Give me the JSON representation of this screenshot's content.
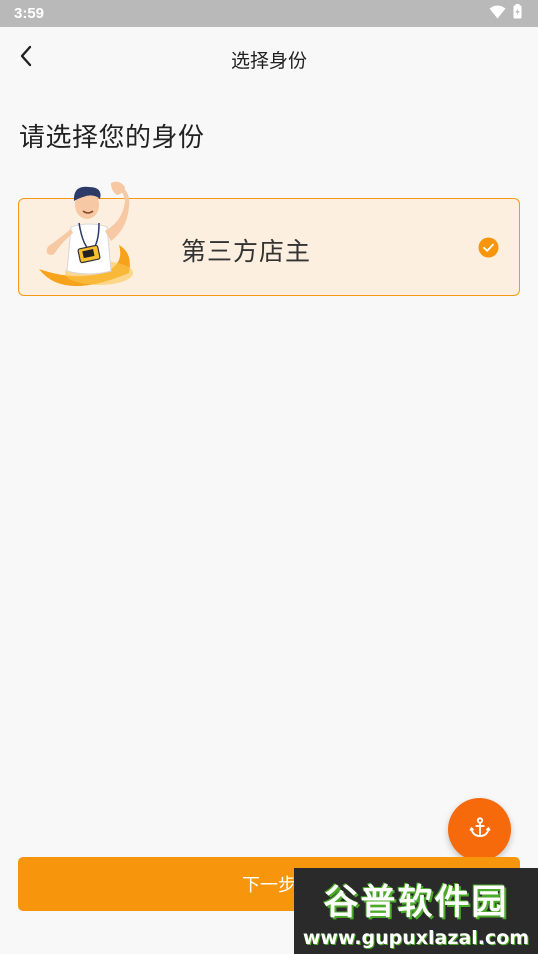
{
  "status_bar": {
    "time": "3:59"
  },
  "app_bar": {
    "title": "选择身份"
  },
  "heading": "请选择您的身份",
  "roles": [
    {
      "label": "第三方店主",
      "selected": true
    }
  ],
  "actions": {
    "next_label": "下一步"
  },
  "watermark": {
    "title": "谷普软件园",
    "url": "www.gupuxlazal.com"
  },
  "colors": {
    "accent": "#f7960d",
    "card_bg": "#fcefe0",
    "card_border": "#f39a17",
    "fab": "#f66a0c",
    "status_bar": "#b9b9b9"
  },
  "icons": {
    "back": "chevron-left-icon",
    "check": "check-circle-icon",
    "fab": "anchor-icon",
    "wifi": "wifi-icon",
    "battery": "battery-icon"
  }
}
